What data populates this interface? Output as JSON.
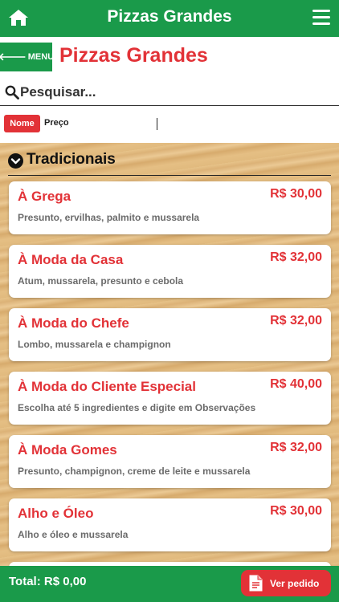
{
  "header": {
    "title": "Pizzas Grandes",
    "home_icon": "home-icon",
    "menu_icon": "hamburger-menu-icon"
  },
  "back_button": {
    "label": "MENU",
    "arrow": "🡐"
  },
  "page_title": "Pizzas Grandes",
  "search": {
    "placeholder": "Pesquisar..."
  },
  "sort": {
    "name_label": "Nome",
    "price_label": "Preço"
  },
  "category": {
    "label": "Tradicionais"
  },
  "items": [
    {
      "name": "À Grega",
      "price": "R$ 30,00",
      "description": "Presunto, ervilhas, palmito e mussarela"
    },
    {
      "name": "À Moda da Casa",
      "price": "R$ 32,00",
      "description": "Atum, mussarela, presunto e cebola"
    },
    {
      "name": "À Moda do Chefe",
      "price": "R$ 32,00",
      "description": "Lombo, mussarela e champignon"
    },
    {
      "name": "À Moda do Cliente Especial",
      "price": "R$ 40,00",
      "description": "Escolha até 5 ingredientes e digite em Observações"
    },
    {
      "name": "À Moda Gomes",
      "price": "R$ 32,00",
      "description": "Presunto, champignon, creme de leite e mussarela"
    },
    {
      "name": "Alho e Óleo",
      "price": "R$ 30,00",
      "description": "Alho e óleo e mussarela"
    }
  ],
  "footer": {
    "total": "Total: R$ 0,00",
    "order_button": "Ver pedido"
  },
  "colors": {
    "green": "#1a9a4a",
    "red": "#e23237"
  }
}
